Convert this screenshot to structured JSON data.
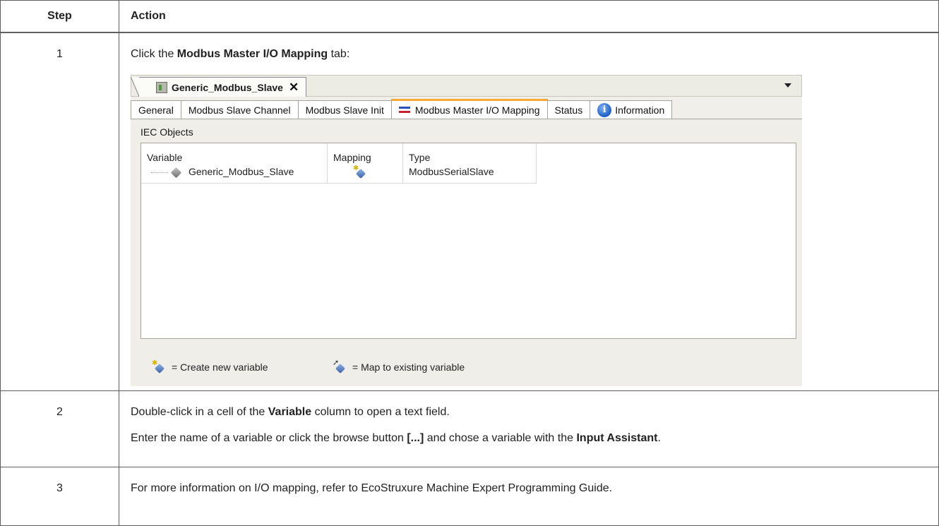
{
  "table": {
    "header_step": "Step",
    "header_action": "Action"
  },
  "rows": [
    {
      "step": "1",
      "line1_pre": "Click the ",
      "line1_bold": "Modbus Master I/O Mapping",
      "line1_post": " tab:"
    },
    {
      "step": "2",
      "line1_pre": "Double-click in a cell of the ",
      "line1_bold": "Variable",
      "line1_post": " column to open a text field.",
      "line2_pre": "Enter the name of a variable or click the browse button ",
      "line2_bold1": "[...]",
      "line2_mid": " and chose a variable with the ",
      "line2_bold2": "Input Assistant",
      "line2_post": "."
    },
    {
      "step": "3",
      "line1": "For more information on I/O mapping, refer to EcoStruxure Machine Expert Programming Guide."
    }
  ],
  "panel": {
    "doc_tab_title": "Generic_Modbus_Slave",
    "close_glyph": "✕",
    "tabs": [
      {
        "label": "General",
        "active": false
      },
      {
        "label": "Modbus Slave Channel",
        "active": false
      },
      {
        "label": "Modbus Slave Init",
        "active": false
      },
      {
        "label": "Modbus Master I/O Mapping",
        "active": true,
        "icon": "swap-arrows-icon"
      },
      {
        "label": "Status",
        "active": false
      },
      {
        "label": "Information",
        "active": false,
        "icon": "info-icon"
      }
    ],
    "section_label": "IEC Objects",
    "columns": [
      "Variable",
      "Mapping",
      "Type"
    ],
    "grid_rows": [
      {
        "variable": "Generic_Modbus_Slave",
        "mapping_icon": "create-new-variable-icon",
        "type": "ModbusSerialSlave"
      }
    ],
    "legend": {
      "create": "= Create new variable",
      "map": "= Map to existing variable"
    },
    "colors": {
      "active_tab_accent": "#f6a935",
      "panel_bg": "#efeee8",
      "border": "#5f5f5f"
    }
  }
}
